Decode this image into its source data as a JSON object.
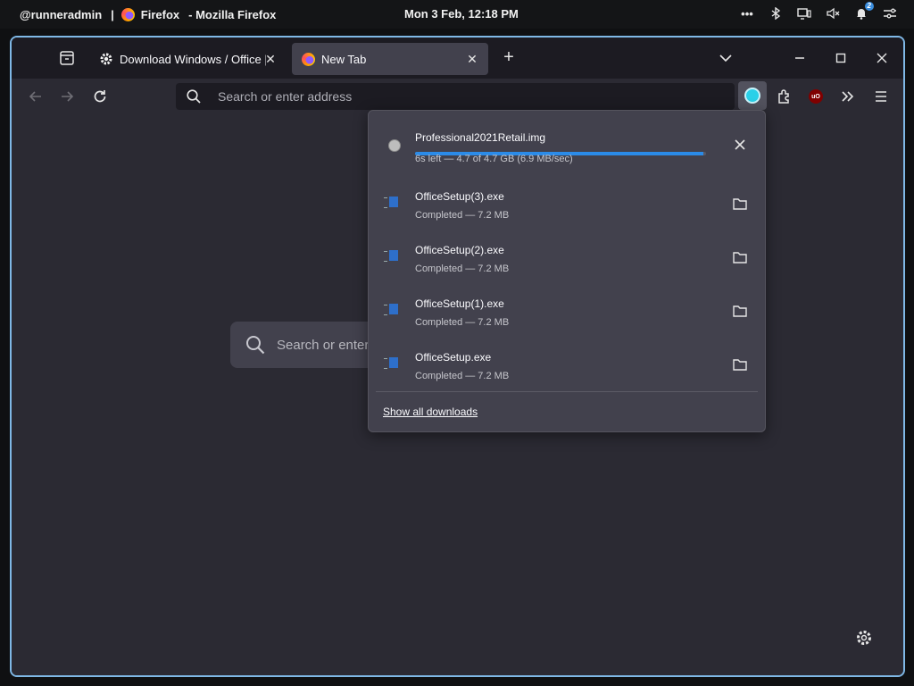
{
  "system_bar": {
    "user": "@runneradmin",
    "separator": "|",
    "app_name": "Firefox",
    "window_title": "Mozilla Firefox",
    "clock": "Mon 3 Feb, 12:18 PM",
    "notification_count": "2"
  },
  "tabs": [
    {
      "title": "Download Windows / Office | M",
      "favicon": "gear-icon",
      "active": false
    },
    {
      "title": "New Tab",
      "favicon": "firefox-icon",
      "active": true
    }
  ],
  "urlbar": {
    "placeholder": "Search or enter address"
  },
  "newtab": {
    "search_placeholder": "Search or enter address"
  },
  "downloads": {
    "active": {
      "name": "Professional2021Retail.img",
      "status": "6s left — 4.7 of 4.7 GB (6.9 MB/sec)",
      "progress": 0.99
    },
    "completed": [
      {
        "name": "OfficeSetup(3).exe",
        "status": "Completed — 7.2 MB"
      },
      {
        "name": "OfficeSetup(2).exe",
        "status": "Completed — 7.2 MB"
      },
      {
        "name": "OfficeSetup(1).exe",
        "status": "Completed — 7.2 MB"
      },
      {
        "name": "OfficeSetup.exe",
        "status": "Completed — 7.2 MB"
      }
    ],
    "show_all_label": "Show all downloads"
  },
  "colors": {
    "accent": "#2b8be8",
    "window_border": "#7fb8e6",
    "download_indicator": "#2ad0e8"
  }
}
